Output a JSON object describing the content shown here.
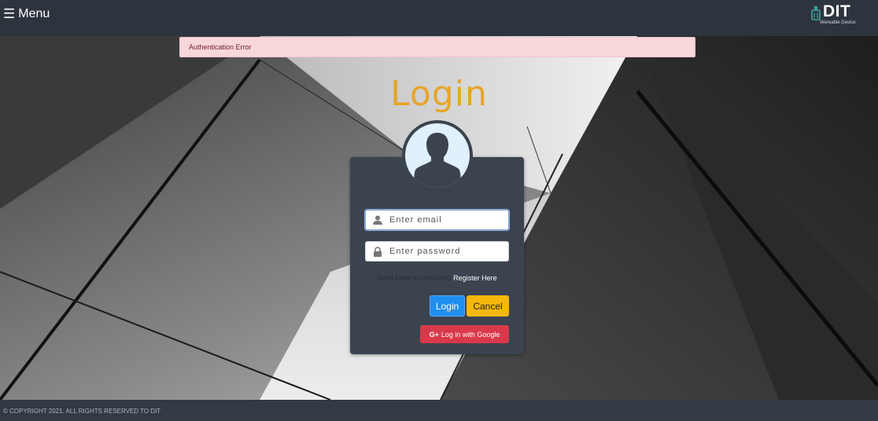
{
  "header": {
    "menu_icon": "☰",
    "menu_label": "Menu",
    "logo_text": "DIT",
    "logo_subtitle": "Wereable Device"
  },
  "alert": {
    "message": "Authentication Error"
  },
  "login": {
    "title": "Login",
    "email_placeholder": "Enter email",
    "password_placeholder": "Enter password",
    "register_question": "Don't have an account? ",
    "register_link": "Register Here",
    "login_button": "Login",
    "cancel_button": "Cancel",
    "google_icon": "G+",
    "google_button": "Log in with Google"
  },
  "footer": {
    "copyright": "© COPYRIGHT 2021. ALL RIGHTS RESERVED TO DIT"
  },
  "colors": {
    "title": "#e6a52a",
    "card": "#3b434f",
    "login_button": "#1e8ff0",
    "cancel_button": "#f6b70f",
    "google_button": "#d9394a",
    "alert_bg": "#f8d7da"
  }
}
